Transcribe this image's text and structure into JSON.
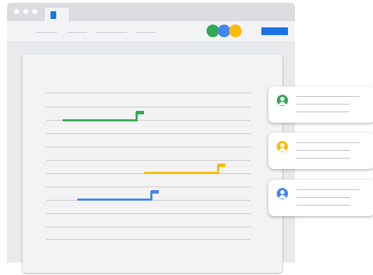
{
  "colors": {
    "green": "#34a853",
    "blue": "#4285f4",
    "yellow": "#fbbc04",
    "tab_icon": "#1a73e8",
    "toolbar_button": "#1a73e8"
  },
  "toolbar": {
    "circles": [
      "green",
      "blue",
      "yellow"
    ]
  },
  "document": {
    "marks": [
      {
        "color": "green",
        "icon": "flag-icon"
      },
      {
        "color": "yellow",
        "icon": "flag-icon"
      },
      {
        "color": "blue",
        "icon": "flag-icon"
      }
    ]
  },
  "comments": [
    {
      "color": "green",
      "icon": "person-icon"
    },
    {
      "color": "yellow",
      "icon": "person-icon"
    },
    {
      "color": "blue",
      "icon": "person-icon"
    }
  ]
}
